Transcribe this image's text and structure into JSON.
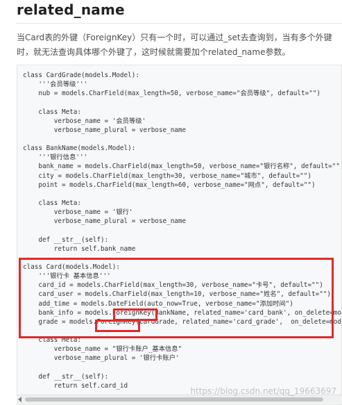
{
  "article": {
    "title": "related_name",
    "intro_line1": "当Card表的外键（ForeignKey）只有一个时，可以通过_set去查询到，当有多个外键",
    "intro_line2": "时，就无法查询具体哪个外键了，这时候就需要加个related_name参数。"
  },
  "code_lines": [
    "class CardGrade(models.Model):",
    "    '''会员等级'''",
    "    nub = models.CharField(max_length=50, verbose_name=\"会员等级\", default=\"\")",
    "",
    "    class Meta:",
    "        verbose_name = '会员等级'",
    "        verbose_name_plural = verbose_name",
    "",
    "class BankName(models.Model):",
    "    '''银行信息'''",
    "    bank_name = models.CharField(max_length=50, verbose_name=\"银行名称\", default=\"\")",
    "    city = models.CharField(max_length=30, verbose_name=\"城市\", default=\"\")",
    "    point = models.CharField(max_length=60, verbose_name=\"网点\", default=\"\")",
    "",
    "    class Meta:",
    "        verbose_name = '银行'",
    "        verbose_name_plural = verbose_name",
    "",
    "    def __str__(self):",
    "        return self.bank_name",
    "",
    "class Card(models.Model):",
    "    '''银行卡 基本信息'''",
    "    card_id = models.CharField(max_length=30, verbose_name=\"卡号\", default=\"\")",
    "    card_user = models.CharField(max_length=10, verbose_name=\"姓名\", default=\"\")",
    "    add_time = models.DateField(auto_now=True, verbose_name=\"添加时间\")",
    "    bank_info = models.ForeignKey(BankName, related_name='card_bank', on_delete=models.CASCADE)",
    "    grade = models.ForeignKey(CardGrade, related_name='card_grade',  on_delete=models.CASCADE)",
    "",
    "    class Meta:",
    "        verbose_name = \"银行卡账户_基本信息\"",
    "        verbose_name_plural = '银行卡账户'",
    "",
    "    def __str__(self):",
    "        return self.card_id"
  ],
  "watermark": "https://blog.csdn.net/qq_19663697"
}
